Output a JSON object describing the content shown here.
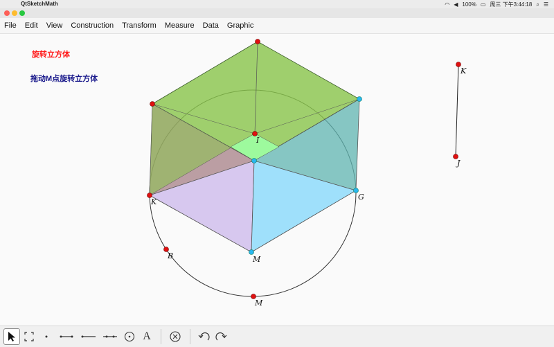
{
  "system_bar": {
    "app_name": "QtSketchMath",
    "battery": "100%",
    "datetime": "周三 下午3:44:18"
  },
  "menu": [
    "File",
    "Edit",
    "View",
    "Construction",
    "Transform",
    "Measure",
    "Data",
    "Graphic"
  ],
  "canvas": {
    "title_text": "旋转立方体",
    "title_color": "#ff0000",
    "instruction_text": "拖动M点旋转立方体",
    "instruction_color": "#1a1a8c"
  },
  "points": {
    "I": "I",
    "K": "K",
    "G": "G",
    "M": "M",
    "B": "B",
    "M2": "M",
    "K2": "K",
    "J": "J"
  },
  "faces": {
    "top_color": "#88c44a",
    "left_color": "#a57f86",
    "right_color": "#5fb4b0",
    "bottom_left_color": "#d7c8ef",
    "bottom_right_color": "#9fe0fb",
    "center_color": "#9dfa9d"
  },
  "toolbar": {
    "tools": [
      "select-arrow-icon",
      "marquee-select-icon",
      "point-tool-icon",
      "segment-tool-icon",
      "ray-tool-icon",
      "line-tool-icon",
      "circle-tool-icon",
      "text-tool-icon",
      "delete-tool-icon",
      "undo-icon",
      "redo-icon"
    ],
    "text_tool_label": "A"
  }
}
